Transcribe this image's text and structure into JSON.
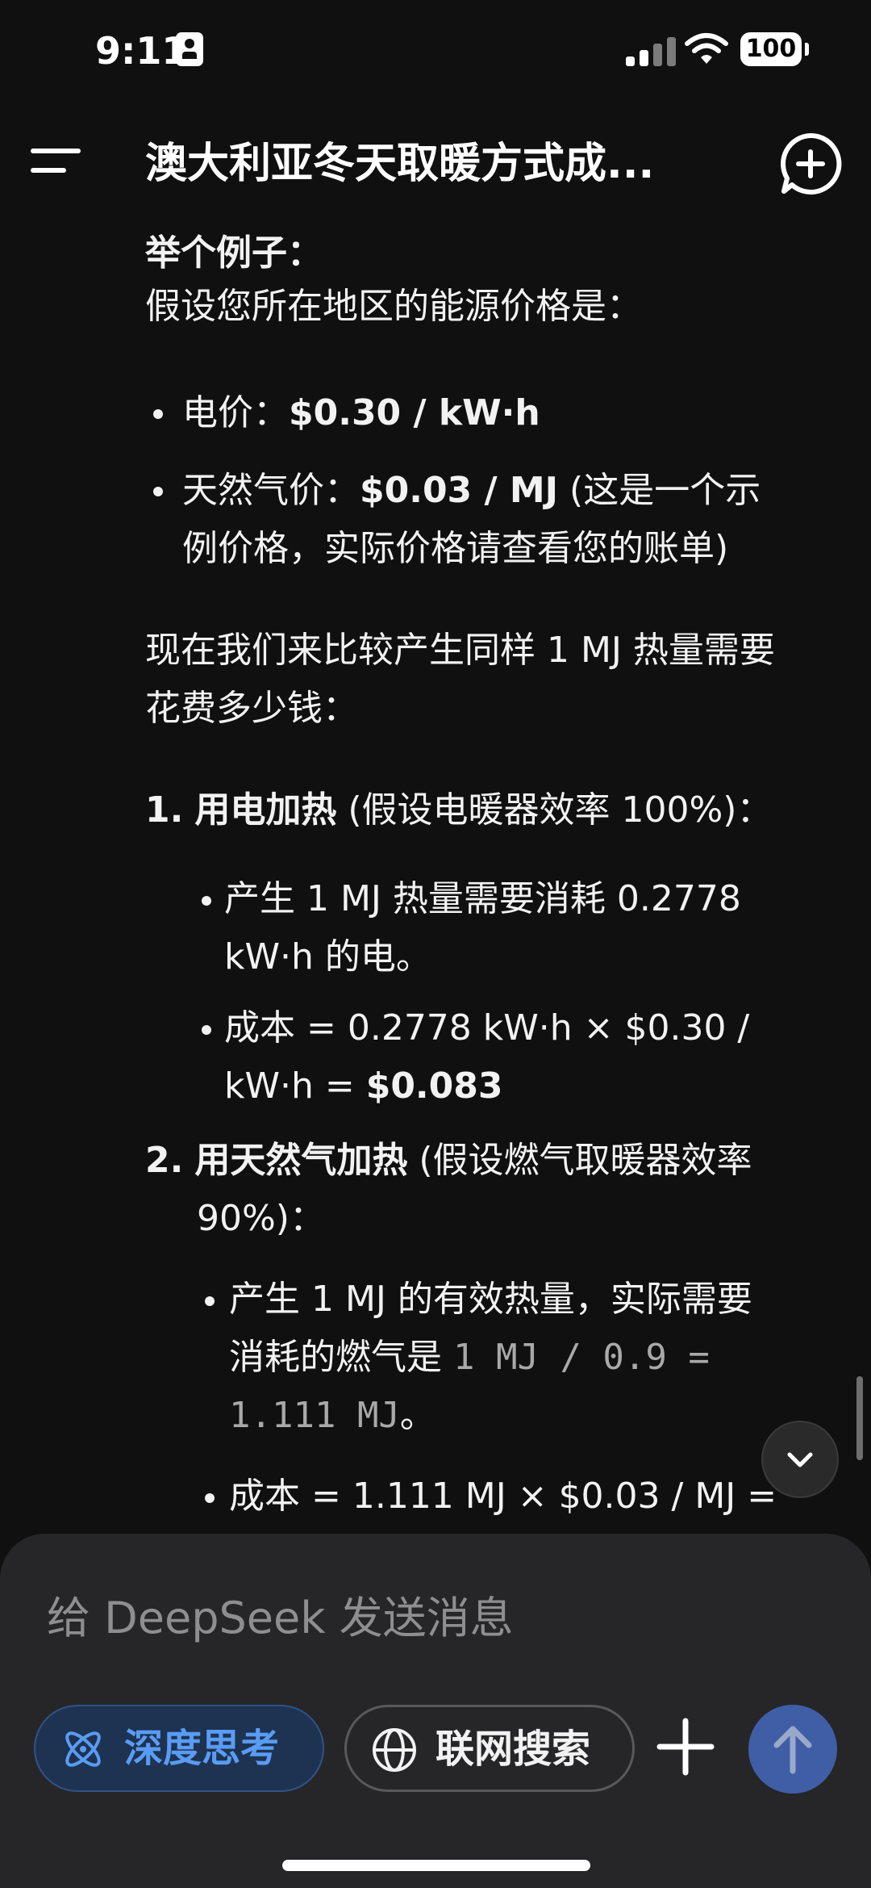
{
  "status_bar": {
    "time": "9:11",
    "battery": "100"
  },
  "header": {
    "title": "澳大利亚冬天取暖方式成..."
  },
  "message": {
    "example_heading": "举个例子：",
    "price_intro": "假设您所在地区的能源价格是：",
    "prices": [
      {
        "label": "电价：",
        "value": "$0.30 / kW·h",
        "note": ""
      },
      {
        "label": "天然气价：",
        "value": "$0.03 / MJ",
        "note": " (这是一个示",
        "note2": "例价格，实际价格请查看您的账单)"
      }
    ],
    "compare_intro": [
      "现在我们来比较产生同样 1 MJ 热量需要",
      "花费多少钱："
    ],
    "methods": [
      {
        "number": "1.",
        "title": "用电加热",
        "note": " (假设电暖器效率 100%)：",
        "points": [
          {
            "lines": [
              "产生 1 MJ 热量需要消耗 0.2778",
              "kW·h 的电。"
            ]
          },
          {
            "line1": "成本 = 0.2778 kW·h × $0.30 /",
            "line2_pre": "kW·h = ",
            "line2_bold": "$0.083"
          }
        ]
      },
      {
        "number": "2.",
        "title": "用天然气加热",
        "note": " (假设燃气取暖器效率",
        "note2": "90%)：",
        "points": [
          {
            "line1": "产生 1 MJ 的有效热量，实际需要",
            "line2_pre": "消耗的燃气是 ",
            "line2_code": "1 MJ / 0.9 =",
            "line3_code": "1.111 MJ",
            "line3_post": "。"
          },
          {
            "line1": "成本 = 1.111 MJ × $0.03 / MJ ="
          }
        ]
      }
    ]
  },
  "composer": {
    "placeholder": "给 DeepSeek 发送消息",
    "deep_think_label": "深度思考",
    "web_search_label": "联网搜索"
  },
  "colors": {
    "background": "#101010",
    "composer": "#262628",
    "accent_blue": "#5a9cf4",
    "send_button": "#3f5ea5"
  }
}
